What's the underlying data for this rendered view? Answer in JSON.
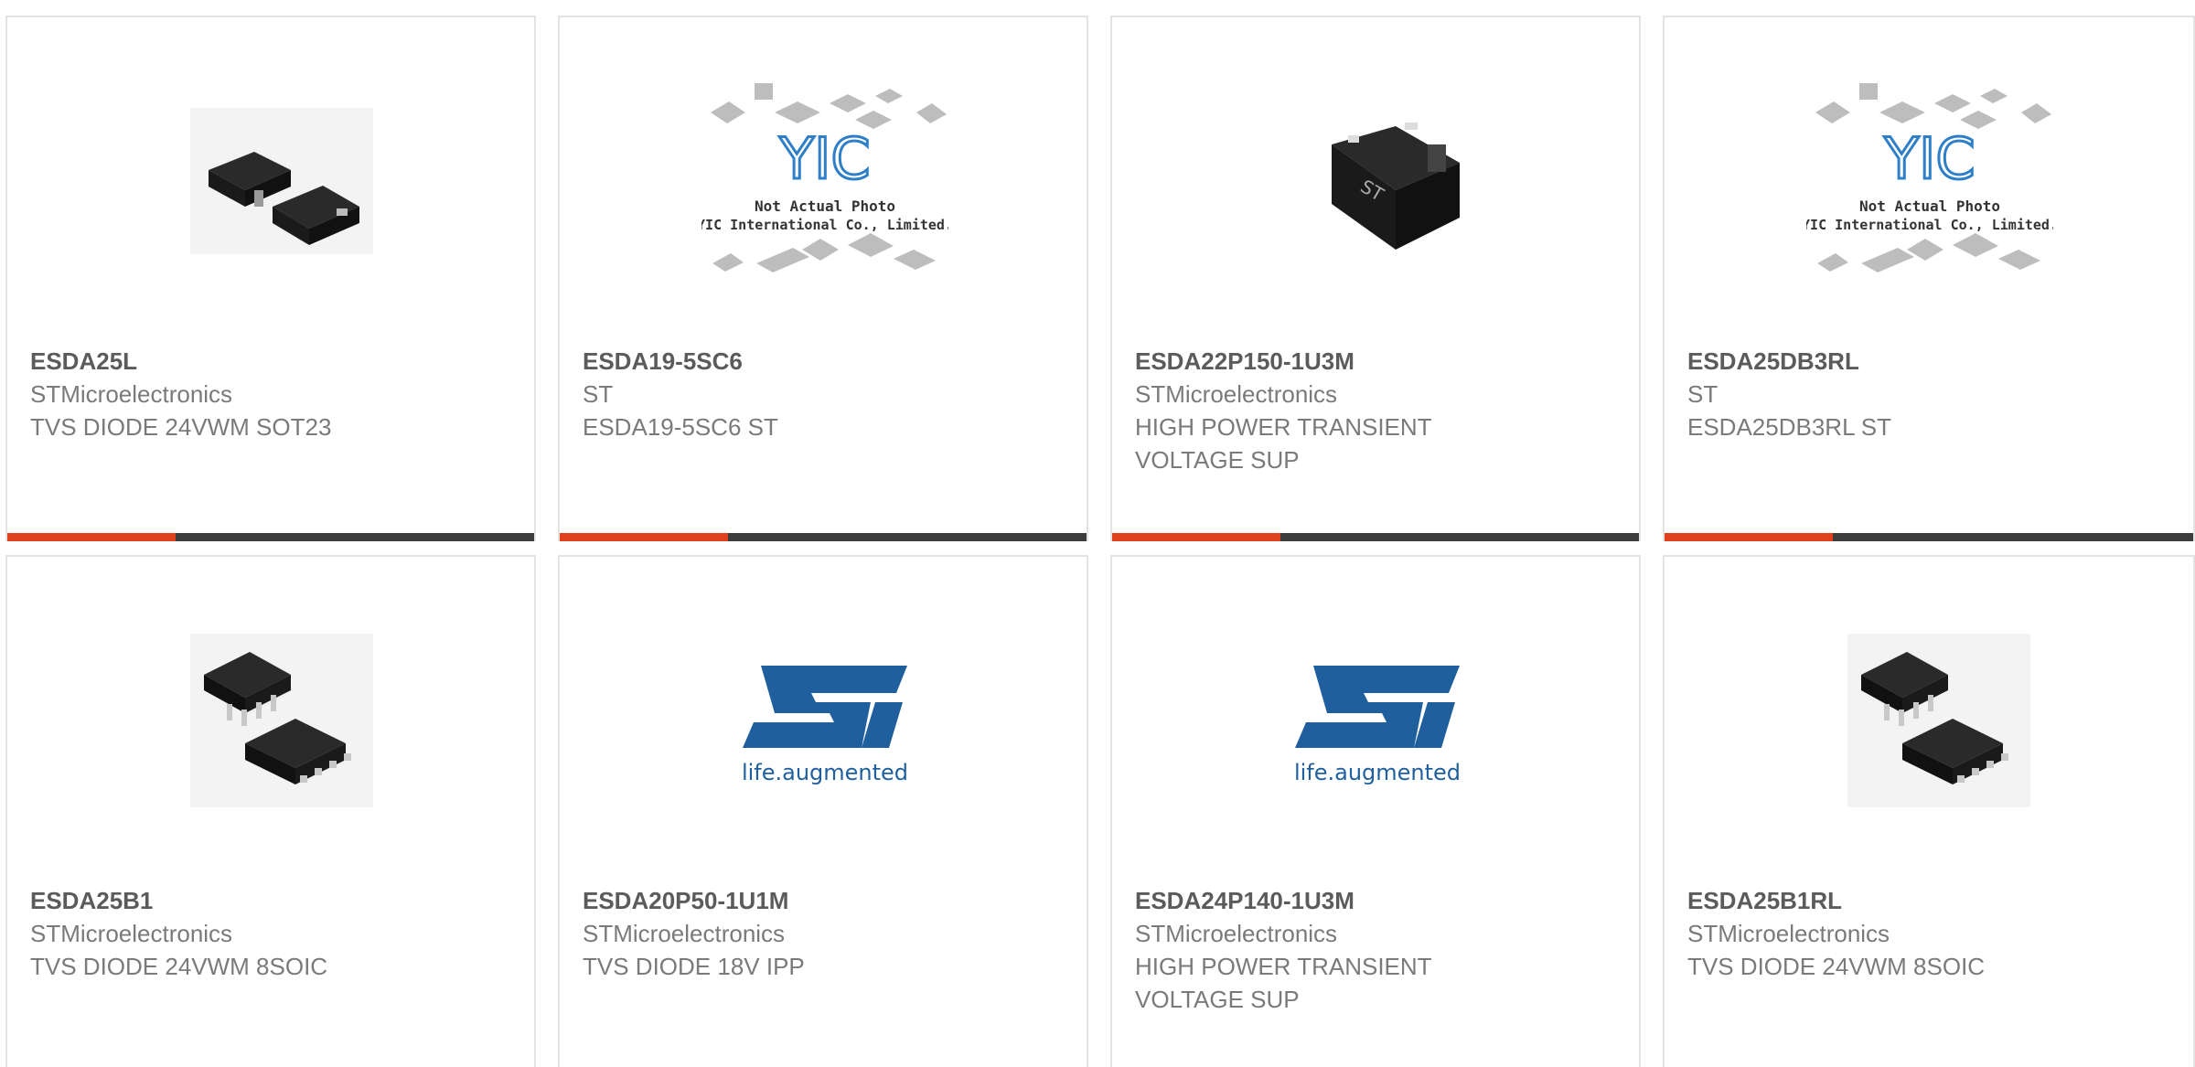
{
  "products": [
    {
      "part": "ESDA25L",
      "manufacturer": "STMicroelectronics",
      "description": "TVS DIODE 24VWM SOT23",
      "image": "sot23-package-icon"
    },
    {
      "part": "ESDA19-5SC6",
      "manufacturer": "ST",
      "description": "ESDA19-5SC6 ST",
      "image": "yic-placeholder-icon",
      "placeholder_text": [
        "Not Actual Photo",
        "YIC International Co., Limited."
      ],
      "placeholder_logo": "YIC"
    },
    {
      "part": "ESDA22P150-1U3M",
      "manufacturer": "STMicroelectronics",
      "description": "HIGH POWER TRANSIENT VOLTAGE SUP",
      "image": "qfn-package-icon"
    },
    {
      "part": "ESDA25DB3RL",
      "manufacturer": "ST",
      "description": "ESDA25DB3RL ST",
      "image": "yic-placeholder-icon",
      "placeholder_text": [
        "Not Actual Photo",
        "YIC International Co., Limited."
      ],
      "placeholder_logo": "YIC"
    },
    {
      "part": "ESDA25B1",
      "manufacturer": "STMicroelectronics",
      "description": "TVS DIODE 24VWM 8SOIC",
      "image": "soic8-package-icon"
    },
    {
      "part": "ESDA20P50-1U1M",
      "manufacturer": "STMicroelectronics",
      "description": "TVS DIODE 18V IPP",
      "image": "st-logo-icon",
      "logo_tagline": "life.augmented"
    },
    {
      "part": "ESDA24P140-1U3M",
      "manufacturer": "STMicroelectronics",
      "description": "HIGH POWER TRANSIENT VOLTAGE SUP",
      "image": "st-logo-icon",
      "logo_tagline": "life.augmented"
    },
    {
      "part": "ESDA25B1RL",
      "manufacturer": "STMicroelectronics",
      "description": "TVS DIODE 24VWM 8SOIC",
      "image": "soic8-package-icon"
    }
  ],
  "colors": {
    "accent": "#e0411b",
    "bar": "#3d3d3d",
    "st_blue": "#1f5f9e"
  }
}
